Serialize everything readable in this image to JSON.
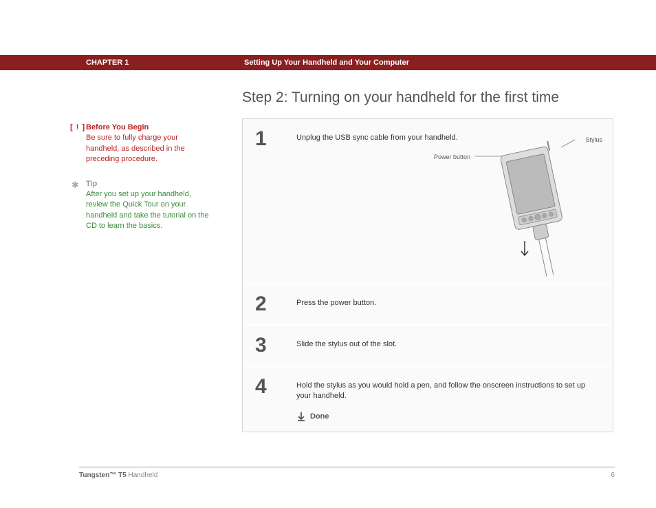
{
  "header": {
    "chapter_label": "CHAPTER 1",
    "chapter_title": "Setting Up Your Handheld and Your Computer"
  },
  "heading": "Step 2: Turning on your handheld for the first time",
  "sidebar": {
    "before": {
      "title": "Before You Begin",
      "body": "Be sure to fully charge your handheld, as described in the preceding procedure."
    },
    "tip": {
      "title": "Tip",
      "body": "After you set up your handheld, review the Quick Tour on your handheld and take the tutorial on the CD to learn the basics."
    }
  },
  "steps": [
    {
      "num": "1",
      "text": "Unplug the USB sync cable from your handheld."
    },
    {
      "num": "2",
      "text": "Press the power button."
    },
    {
      "num": "3",
      "text": "Slide the stylus out of the slot."
    },
    {
      "num": "4",
      "text": "Hold the stylus as you would hold a pen, and follow the onscreen instructions to set up your handheld."
    }
  ],
  "callouts": {
    "power": "Power button",
    "stylus": "Stylus"
  },
  "done_label": "Done",
  "footer": {
    "product_bold": "Tungsten™ T5",
    "product_rest": " Handheld",
    "page": "6"
  }
}
